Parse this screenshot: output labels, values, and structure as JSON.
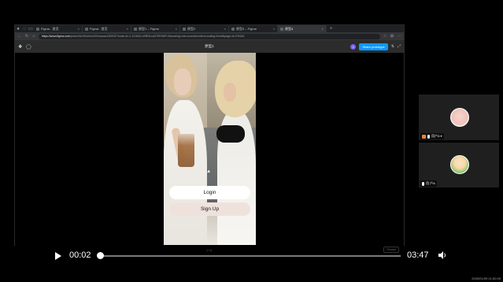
{
  "browser": {
    "tabs": [
      {
        "label": "Figma - 首页"
      },
      {
        "label": "Figma - 首页"
      },
      {
        "label": "原型1 – Figma"
      },
      {
        "label": "原型2"
      },
      {
        "label": "原型3 – Figma"
      },
      {
        "label": "原型4"
      }
    ],
    "url_host": "https://www.figma.com",
    "url_path": "/proto/XkrH5xHnm2fXmuwao11BZ0Z?node-id=1-1216&t=n0RNLsd47EE9MP-0&scaling=min-zoom&content-scaling=fixed&page-id=0%3A1"
  },
  "figma": {
    "title": "原型1",
    "avatar_initial": "1",
    "share_label": "Share prototype"
  },
  "prototype": {
    "login_label": "Login",
    "signup_label": "Sign Up",
    "frame_label": "1 / 6",
    "restart_label": "Restart"
  },
  "player": {
    "current_time": "00:02",
    "total_time": "03:47",
    "progress": 0.009
  },
  "participants": [
    {
      "name": "用户A ▾"
    },
    {
      "name": "用 户A"
    }
  ],
  "timestamp": "2025/01/09 21:52:09"
}
